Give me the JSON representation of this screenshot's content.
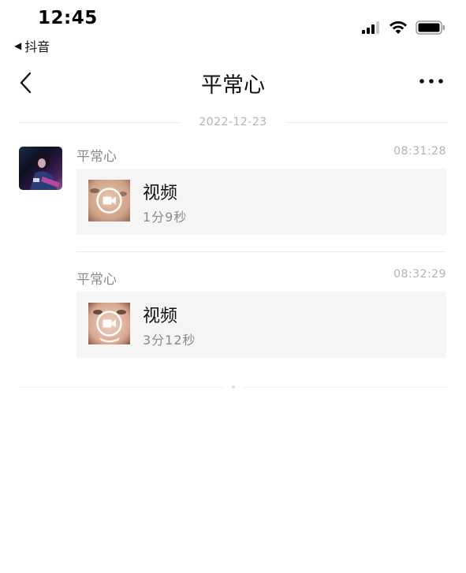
{
  "status_bar": {
    "time": "12:45",
    "back_app_label": "抖音",
    "icons": [
      "signal-icon",
      "wifi-icon",
      "battery-icon"
    ]
  },
  "nav": {
    "back_icon": "chevron-left-icon",
    "title": "平常心",
    "more_icon": "more-horizontal-icon"
  },
  "conversation": {
    "date": "2022-12-23",
    "messages": [
      {
        "sender": "平常心",
        "time": "08:31:28",
        "type_label": "视频",
        "duration": "1分9秒",
        "icon": "video-camera-icon"
      },
      {
        "sender": "平常心",
        "time": "08:32:29",
        "type_label": "视频",
        "duration": "3分12秒",
        "icon": "video-camera-icon"
      }
    ]
  },
  "colors": {
    "background": "#ffffff",
    "card_background": "#f5f5f5",
    "secondary_text": "#8a8a8a",
    "timestamp_text": "#b3b3b3",
    "divider": "#ececec"
  }
}
